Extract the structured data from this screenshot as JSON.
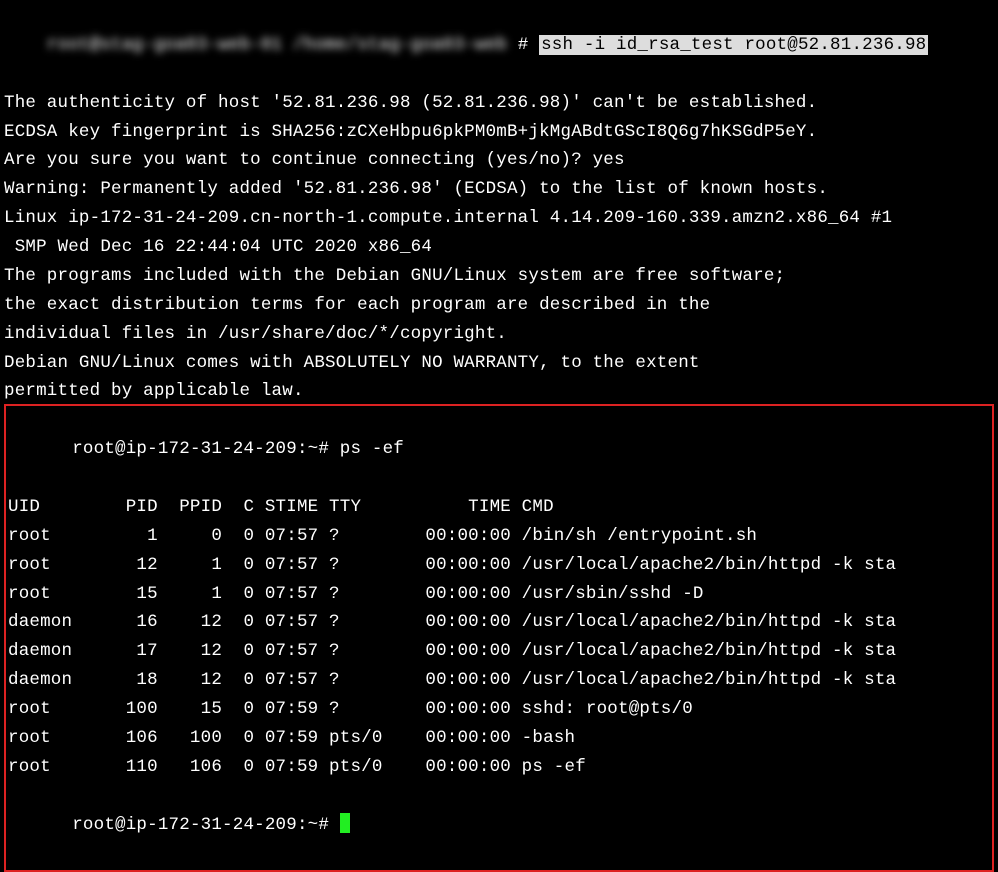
{
  "prompt1_blurred": "root@stag-goa03-web-01 /home/stag-goa03-web",
  "prompt1_hash": " # ",
  "ssh_cmd": "ssh -i id_rsa_test root@52.81.236.98",
  "auth_lines": [
    "The authenticity of host '52.81.236.98 (52.81.236.98)' can't be established.",
    "ECDSA key fingerprint is SHA256:zCXeHbpu6pkPM0mB+jkMgABdtGScI8Q6g7hKSGdP5eY.",
    "Are you sure you want to continue connecting (yes/no)? yes",
    "Warning: Permanently added '52.81.236.98' (ECDSA) to the list of known hosts.",
    "Linux ip-172-31-24-209.cn-north-1.compute.internal 4.14.209-160.339.amzn2.x86_64 #1",
    " SMP Wed Dec 16 22:44:04 UTC 2020 x86_64",
    "",
    "The programs included with the Debian GNU/Linux system are free software;",
    "the exact distribution terms for each program are described in the",
    "individual files in /usr/share/doc/*/copyright.",
    "",
    "Debian GNU/Linux comes with ABSOLUTELY NO WARRANTY, to the extent",
    "permitted by applicable law."
  ],
  "prompt2": "root@ip-172-31-24-209:~# ",
  "ps_cmd": "ps -ef",
  "ps_header": "UID        PID  PPID  C STIME TTY          TIME CMD",
  "ps_rows": [
    "root         1     0  0 07:57 ?        00:00:00 /bin/sh /entrypoint.sh",
    "root        12     1  0 07:57 ?        00:00:00 /usr/local/apache2/bin/httpd -k sta",
    "root        15     1  0 07:57 ?        00:00:00 /usr/sbin/sshd -D",
    "daemon      16    12  0 07:57 ?        00:00:00 /usr/local/apache2/bin/httpd -k sta",
    "daemon      17    12  0 07:57 ?        00:00:00 /usr/local/apache2/bin/httpd -k sta",
    "daemon      18    12  0 07:57 ?        00:00:00 /usr/local/apache2/bin/httpd -k sta",
    "root       100    15  0 07:59 ?        00:00:00 sshd: root@pts/0",
    "root       106   100  0 07:59 pts/0    00:00:00 -bash",
    "root       110   106  0 07:59 pts/0    00:00:00 ps -ef"
  ],
  "prompt3": "root@ip-172-31-24-209:~# "
}
